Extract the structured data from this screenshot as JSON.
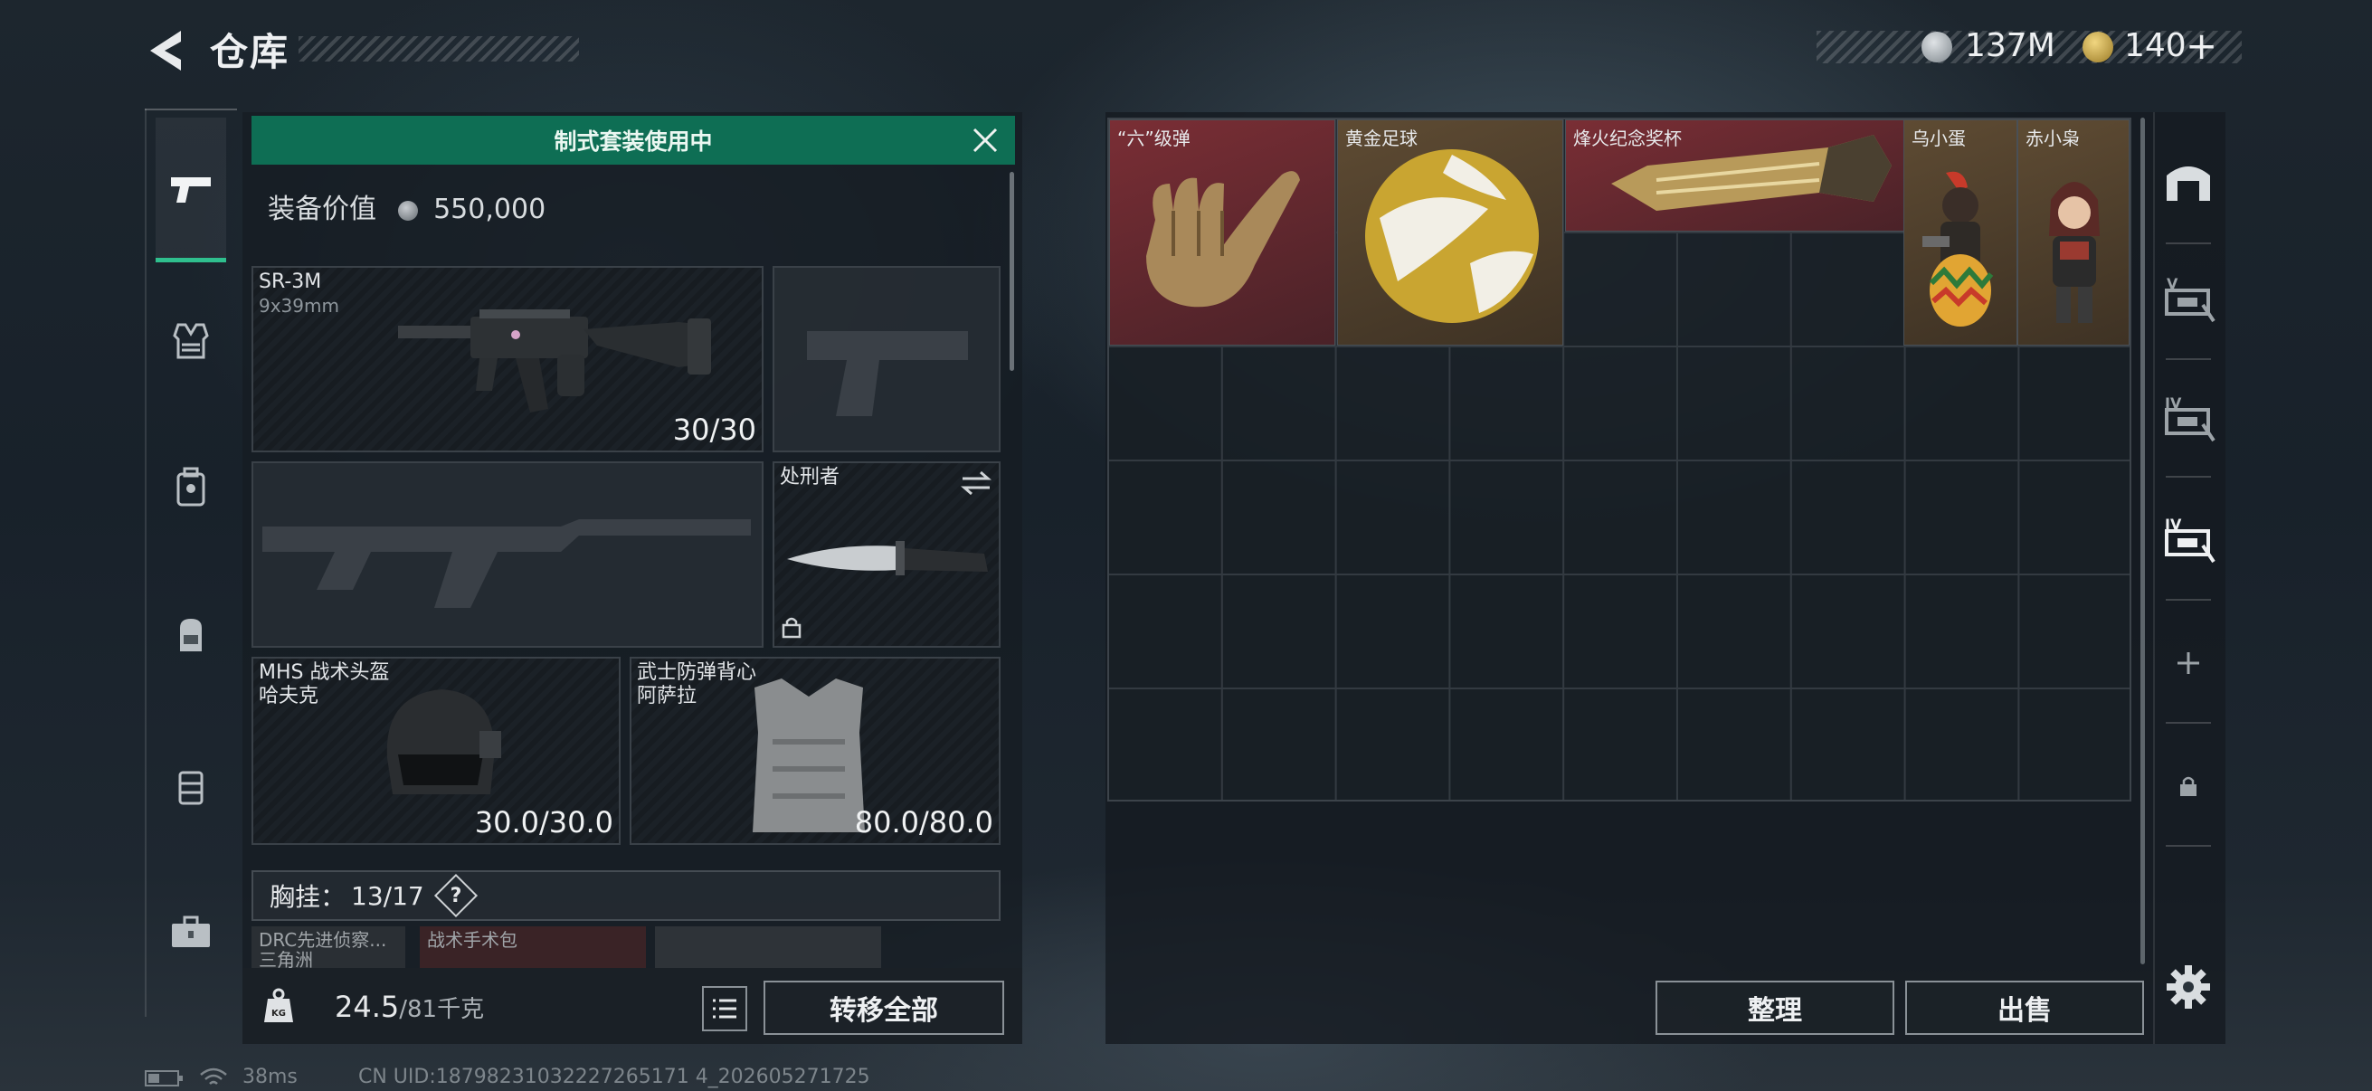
{
  "header": {
    "title": "仓库",
    "currency_silver": "137M",
    "currency_gold": "140",
    "add_label": "+"
  },
  "loadout": {
    "banner": "制式套装使用中",
    "value_label": "装备价值",
    "value": "550,000",
    "primary": {
      "name": "SR-3M",
      "caliber": "9x39mm",
      "ammo": "30/30"
    },
    "melee": {
      "name": "处刑者"
    },
    "helmet": {
      "name": "MHS 战术头盔",
      "sub": "哈夫克",
      "durability": "30.0/30.0"
    },
    "armor": {
      "name": "武士防弹背心",
      "sub": "阿萨拉",
      "durability": "80.0/80.0"
    },
    "chest_rig": {
      "label": "胸挂：",
      "count": "13/17",
      "help": "?"
    },
    "rig_items": [
      "DRC先进侦察...",
      "战术手术包",
      ""
    ],
    "rig_item_sub": "三角洲",
    "weight": "24.5",
    "weight_max": "/81千克",
    "transfer_all": "转移全部"
  },
  "stash": {
    "items": [
      {
        "name": "“六”级弹",
        "rarity_color": "#6a2a30"
      },
      {
        "name": "黄金足球",
        "rarity_color": "#5a4a30"
      },
      {
        "name": "烽火纪念奖杯",
        "rarity_color": "#6a2a30"
      },
      {
        "name": "乌小蛋",
        "rarity_color": "#5a4a30"
      },
      {
        "name": "赤小枭",
        "rarity_color": "#5a4a30"
      }
    ],
    "sort_label": "整理",
    "sell_label": "出售"
  },
  "right_tabs": [
    "V",
    "IV",
    "IV"
  ],
  "footer": {
    "ping": "38ms",
    "uid": "CN UID:18798231032227265171 4_202605271725"
  }
}
